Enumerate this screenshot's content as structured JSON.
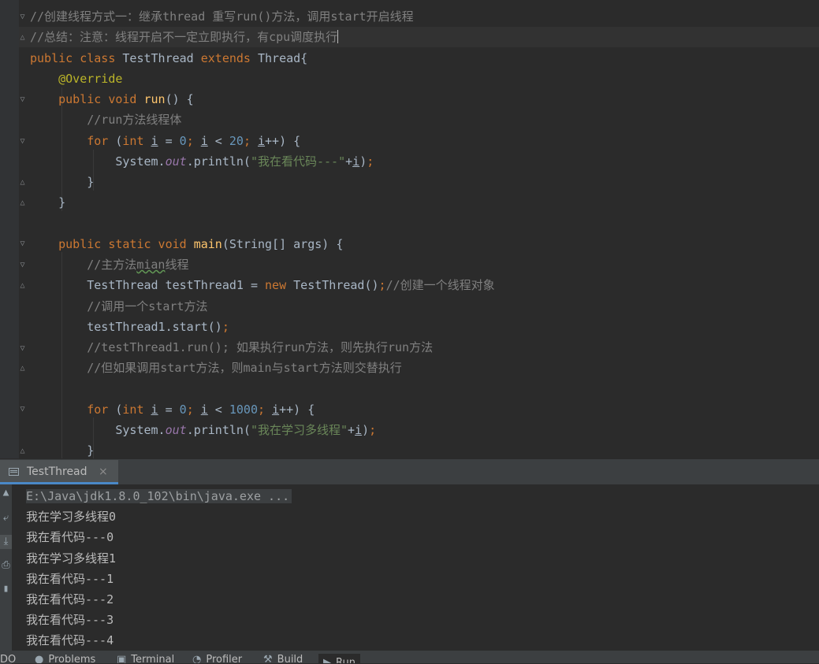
{
  "editor": {
    "lines": [
      {
        "tokens": [
          {
            "t": "//创建线程方式一：继承thread 重写run()方法，调用start开启线程",
            "c": "cm"
          }
        ]
      },
      {
        "tokens": [
          {
            "t": "//总结：注意：线程开启不一定立即执行，有cpu调度执行",
            "c": "cm"
          }
        ],
        "caret": true
      },
      {
        "tokens": [
          {
            "t": "public class ",
            "c": "kw"
          },
          {
            "t": "TestThread "
          },
          {
            "t": "extends ",
            "c": "kw"
          },
          {
            "t": "Thread{"
          }
        ]
      },
      {
        "tokens": [
          {
            "t": "    "
          },
          {
            "t": "@Override",
            "c": "an"
          }
        ]
      },
      {
        "tokens": [
          {
            "t": "    "
          },
          {
            "t": "public void ",
            "c": "kw"
          },
          {
            "t": "run",
            "c": "fn"
          },
          {
            "t": "() {"
          }
        ]
      },
      {
        "tokens": [
          {
            "t": "        "
          },
          {
            "t": "//run方法线程体",
            "c": "cm"
          }
        ]
      },
      {
        "tokens": [
          {
            "t": "        "
          },
          {
            "t": "for ",
            "c": "kw"
          },
          {
            "t": "("
          },
          {
            "t": "int ",
            "c": "kw"
          },
          {
            "t": "i",
            "c": "var"
          },
          {
            "t": " = "
          },
          {
            "t": "0",
            "c": "num"
          },
          {
            "t": "; ",
            "c": "kw"
          },
          {
            "t": "i",
            "c": "var"
          },
          {
            "t": " < "
          },
          {
            "t": "20",
            "c": "num"
          },
          {
            "t": "; ",
            "c": "kw"
          },
          {
            "t": "i",
            "c": "var"
          },
          {
            "t": "++) {"
          }
        ]
      },
      {
        "tokens": [
          {
            "t": "            "
          },
          {
            "t": "System."
          },
          {
            "t": "out",
            "c": "st"
          },
          {
            "t": ".println("
          },
          {
            "t": "\"我在看代码---\"",
            "c": "str"
          },
          {
            "t": "+"
          },
          {
            "t": "i",
            "c": "var"
          },
          {
            "t": ")"
          },
          {
            "t": ";",
            "c": "kw"
          }
        ]
      },
      {
        "tokens": [
          {
            "t": "        }"
          }
        ]
      },
      {
        "tokens": [
          {
            "t": "    }"
          }
        ]
      },
      {
        "tokens": [
          {
            "t": ""
          }
        ]
      },
      {
        "tokens": [
          {
            "t": "    "
          },
          {
            "t": "public static void ",
            "c": "kw"
          },
          {
            "t": "main",
            "c": "fn"
          },
          {
            "t": "(String[] args) {"
          }
        ]
      },
      {
        "tokens": [
          {
            "t": "        "
          },
          {
            "t": "//主方法",
            "c": "cm"
          },
          {
            "t": "mian",
            "c": "cm typo"
          },
          {
            "t": "线程",
            "c": "cm"
          }
        ]
      },
      {
        "tokens": [
          {
            "t": "        "
          },
          {
            "t": "TestThread testThread1 = "
          },
          {
            "t": "new ",
            "c": "kw"
          },
          {
            "t": "TestThread()"
          },
          {
            "t": ";",
            "c": "kw"
          },
          {
            "t": "//创建一个线程对象",
            "c": "cm"
          }
        ]
      },
      {
        "tokens": [
          {
            "t": "        "
          },
          {
            "t": "//调用一个start方法",
            "c": "cm"
          }
        ]
      },
      {
        "tokens": [
          {
            "t": "        "
          },
          {
            "t": "testThread1.start()"
          },
          {
            "t": ";",
            "c": "kw"
          }
        ]
      },
      {
        "tokens": [
          {
            "t": "        "
          },
          {
            "t": "//testThread1.run(); 如果执行run方法，则先执行run方法",
            "c": "cm"
          }
        ]
      },
      {
        "tokens": [
          {
            "t": "        "
          },
          {
            "t": "//但如果调用start方法，则main与start方法则交替执行",
            "c": "cm"
          }
        ]
      },
      {
        "tokens": [
          {
            "t": ""
          }
        ]
      },
      {
        "tokens": [
          {
            "t": "        "
          },
          {
            "t": "for ",
            "c": "kw"
          },
          {
            "t": "("
          },
          {
            "t": "int ",
            "c": "kw"
          },
          {
            "t": "i",
            "c": "var"
          },
          {
            "t": " = "
          },
          {
            "t": "0",
            "c": "num"
          },
          {
            "t": "; ",
            "c": "kw"
          },
          {
            "t": "i",
            "c": "var"
          },
          {
            "t": " < "
          },
          {
            "t": "1000",
            "c": "num"
          },
          {
            "t": "; ",
            "c": "kw"
          },
          {
            "t": "i",
            "c": "var"
          },
          {
            "t": "++) {"
          }
        ]
      },
      {
        "tokens": [
          {
            "t": "            "
          },
          {
            "t": "System."
          },
          {
            "t": "out",
            "c": "st"
          },
          {
            "t": ".println("
          },
          {
            "t": "\"我在学习多线程\"",
            "c": "str"
          },
          {
            "t": "+"
          },
          {
            "t": "i",
            "c": "var"
          },
          {
            "t": ")"
          },
          {
            "t": ";",
            "c": "kw"
          }
        ]
      },
      {
        "tokens": [
          {
            "t": "        }"
          }
        ]
      }
    ]
  },
  "run_panel": {
    "tab_label": "TestThread",
    "tab_close": "×",
    "console_lines": [
      "E:\\Java\\jdk1.8.0_102\\bin\\java.exe ...",
      "我在学习多线程0",
      "我在看代码---0",
      "我在学习多线程1",
      "我在看代码---1",
      "我在看代码---2",
      "我在看代码---3",
      "我在看代码---4"
    ]
  },
  "bottom_bar": {
    "items": [
      {
        "label": "DO",
        "icon": ""
      },
      {
        "label": "Problems",
        "icon": "problems-icon"
      },
      {
        "label": "Terminal",
        "icon": "terminal-icon"
      },
      {
        "label": "Profiler",
        "icon": "profiler-icon"
      },
      {
        "label": "Build",
        "icon": "build-icon"
      },
      {
        "label": "Run",
        "icon": "run-icon"
      }
    ]
  },
  "colors": {
    "background": "#2b2b2b",
    "keyword": "#cc7832",
    "comment": "#808080",
    "string": "#6a8759",
    "number": "#6897bb",
    "function": "#ffc66d",
    "annotation": "#bbb529",
    "static_field": "#9876aa"
  }
}
